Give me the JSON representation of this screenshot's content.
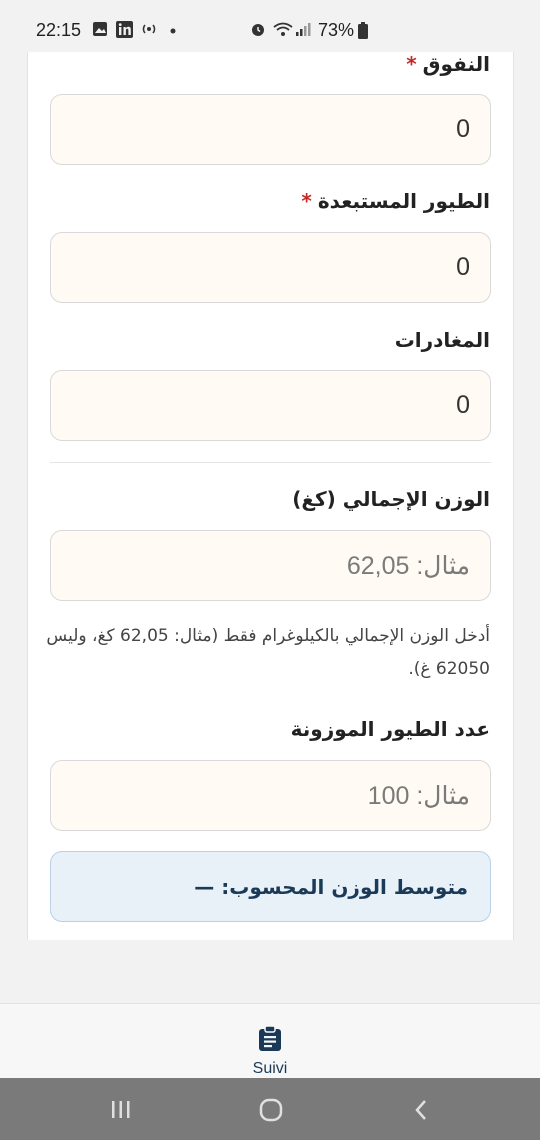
{
  "status_bar": {
    "time": "22:15",
    "battery": "73%",
    "icons": [
      "gallery-icon",
      "linkedin-icon",
      "hotspot-icon",
      "dot-icon",
      "alarm-icon",
      "wifi-icon",
      "signal-icon",
      "battery-icon"
    ]
  },
  "form": {
    "mortality_label": "النفوق",
    "mortality_value": "0",
    "culled_label": "الطيور المستبعدة",
    "culled_value": "0",
    "departures_label": "المغادرات",
    "departures_value": "0",
    "total_weight_label": "الوزن الإجمالي (كغ)",
    "total_weight_placeholder": "مثال: 62,05",
    "total_weight_help": "أدخل الوزن الإجمالي بالكيلوغرام فقط (مثال: 62,05 كغ، وليس 62050 غ).",
    "weighed_count_label": "عدد الطيور الموزونة",
    "weighed_count_placeholder": "مثال: 100",
    "required_marker": "*",
    "avg_weight_text": "متوسط الوزن المحسوب: —"
  },
  "bottom_nav": {
    "active_label": "Suivi",
    "active_icon": "clipboard-icon"
  },
  "colors": {
    "accent": "#1b3a57",
    "required": "#c62828",
    "field_bg": "#fffbf4",
    "info_bg": "#e8f0f8"
  }
}
